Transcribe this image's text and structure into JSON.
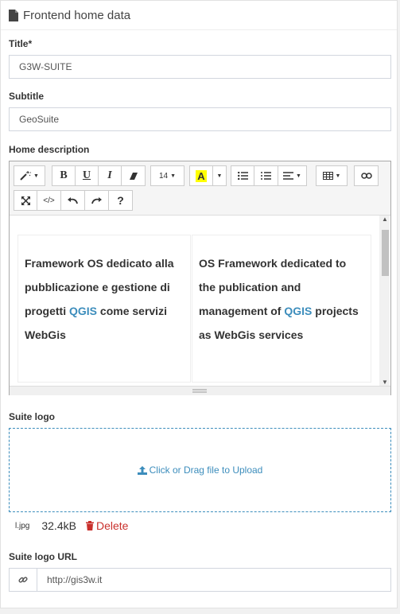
{
  "header": {
    "title": "Frontend home data",
    "icon": "file-icon"
  },
  "fields": {
    "title": {
      "label": "Title*",
      "value": "G3W-SUITE"
    },
    "subtitle": {
      "label": "Subtitle",
      "value": "GeoSuite"
    },
    "description": {
      "label": "Home description"
    },
    "logo": {
      "label": "Suite logo",
      "upload_text": "Click or Drag file to Upload"
    },
    "logo_url": {
      "label": "Suite logo URL",
      "value": "http://gis3w.it"
    }
  },
  "editor": {
    "font_size": "14",
    "col_it": {
      "p1": "Framework OS dedicato alla pubblicazione e gestione di progetti ",
      "hl": "QGIS",
      "p2": " come servizi WebGis"
    },
    "col_en": {
      "p1": "OS Framework dedicated to the publication and management of ",
      "hl": "QGIS",
      "p2": " projects as WebGis services"
    }
  },
  "file": {
    "name": "l.jpg",
    "size": "32.4kB",
    "delete_label": "Delete"
  },
  "colors": {
    "accent": "#3c8dbc",
    "danger": "#c9302c",
    "highlight": "#ffff00"
  }
}
